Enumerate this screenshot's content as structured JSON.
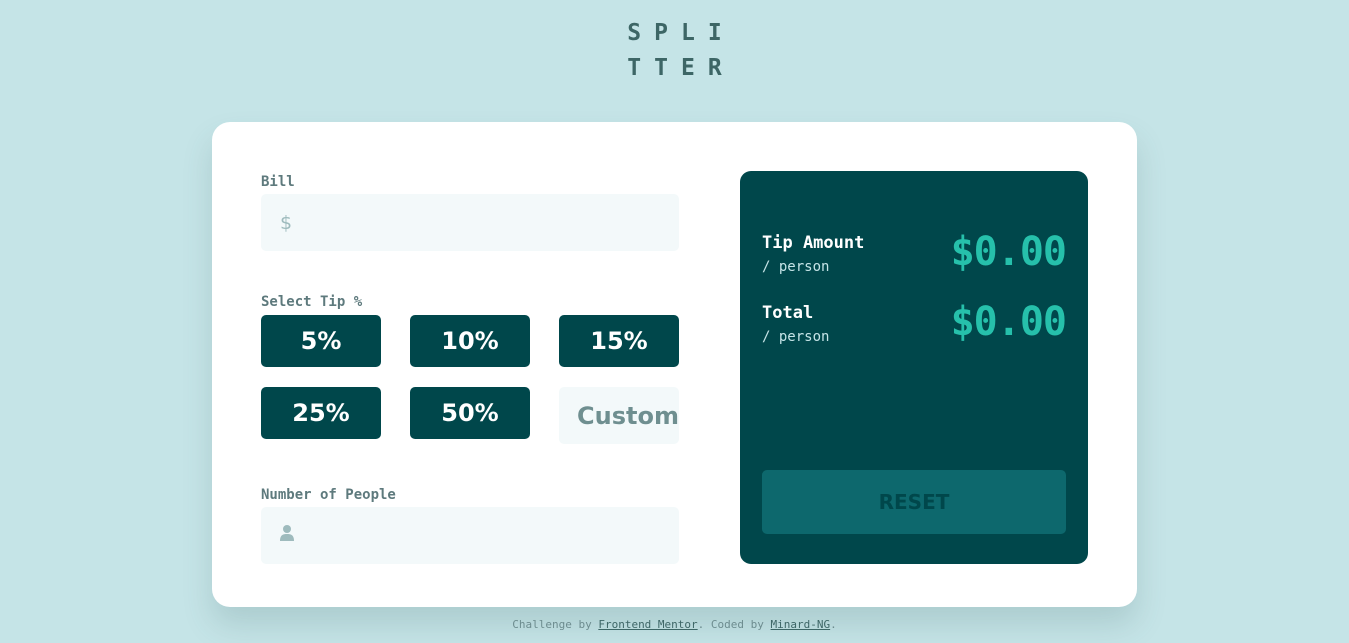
{
  "app": {
    "logo_line1": "SPLI",
    "logo_line2": "TTER"
  },
  "form": {
    "bill": {
      "label": "Bill",
      "icon": "$",
      "value": ""
    },
    "tip": {
      "label": "Select Tip %",
      "options": [
        "5%",
        "10%",
        "15%",
        "25%",
        "50%"
      ],
      "custom_placeholder": "Custom"
    },
    "people": {
      "label": "Number of People",
      "icon": "person-icon",
      "value": ""
    }
  },
  "results": {
    "tip_amount": {
      "title": "Tip Amount",
      "sub": "/ person",
      "value": "$0.00"
    },
    "total": {
      "title": "Total",
      "sub": "/ person",
      "value": "$0.00"
    },
    "reset_label": "RESET"
  },
  "footer": {
    "prefix": "Challenge by ",
    "link1": "Frontend Mentor",
    "middle": ". Coded by ",
    "link2": "Minard-NG",
    "suffix": "."
  },
  "colors": {
    "background": "#c5e4e7",
    "dark_cyan": "#00474b",
    "accent": "#26c0ab",
    "input_bg": "#f3f9fa"
  }
}
